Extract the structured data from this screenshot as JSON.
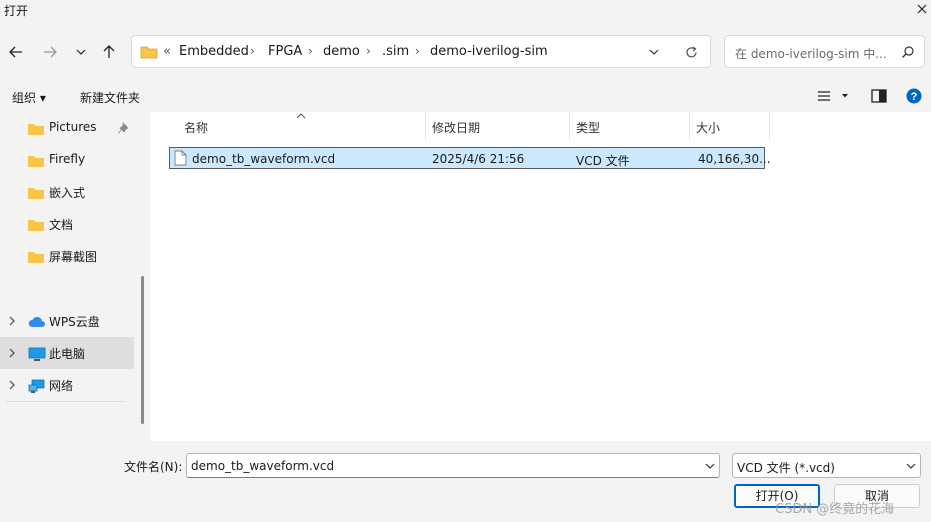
{
  "window": {
    "title": "打开"
  },
  "address": {
    "overflow": "«",
    "crumbs": [
      "Embedded",
      "FPGA",
      "demo",
      ".sim",
      "demo-iverilog-sim"
    ],
    "separator": "›"
  },
  "search": {
    "placeholder": "在 demo-iverilog-sim 中..."
  },
  "toolbar": {
    "organize": "组织 ▾",
    "new_folder": "新建文件夹"
  },
  "sidebar": {
    "quick": [
      "Pictures",
      "Firefly",
      "嵌入式",
      "文档",
      "屏幕截图"
    ],
    "places": [
      {
        "label": "WPS云盘",
        "icon": "cloud-icon"
      },
      {
        "label": "此电脑",
        "icon": "computer-icon"
      },
      {
        "label": "网络",
        "icon": "network-icon"
      }
    ]
  },
  "columns": {
    "name": "名称",
    "modified": "修改日期",
    "type": "类型",
    "size": "大小"
  },
  "files": [
    {
      "name": "demo_tb_waveform.vcd",
      "modified": "2025/4/6 21:56",
      "type": "VCD 文件",
      "size": "40,166,30..."
    }
  ],
  "footer": {
    "filename_label": "文件名(N):",
    "filename_value": "demo_tb_waveform.vcd",
    "filetype_value": "VCD 文件 (*.vcd)",
    "open_label": "打开(O)",
    "cancel_label": "取消",
    "watermark": "CSDN @终竟的花海"
  },
  "colors": {
    "accent": "#0067c0",
    "selection": "#cce8ff",
    "folder": "#f7c34a"
  }
}
